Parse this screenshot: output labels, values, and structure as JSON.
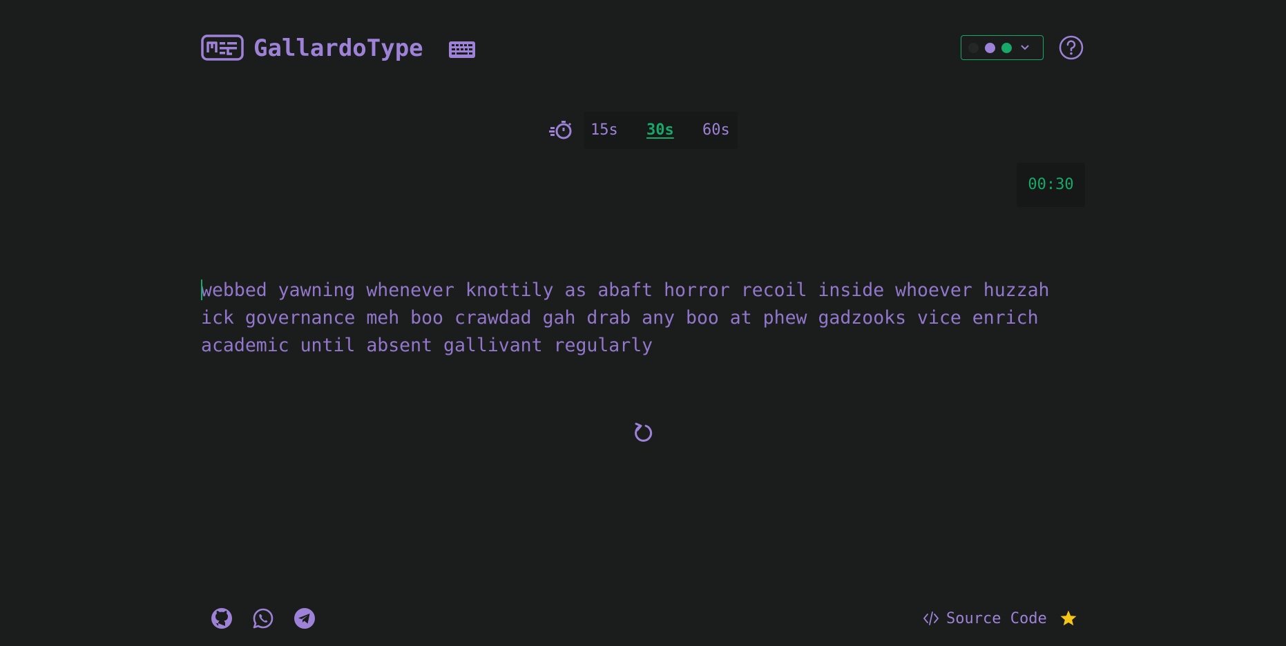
{
  "header": {
    "brand": "GallardoType",
    "logo_icon": "typing-logo-icon",
    "keyboard_icon": "keyboard-icon",
    "theme_selector": {
      "icon": "chevron-down-icon",
      "swatches": [
        "#232725",
        "#9e82d8",
        "#17a86a"
      ]
    },
    "help_icon": "question-mark-icon"
  },
  "duration": {
    "icon": "timer-icon",
    "options": [
      "15s",
      "30s",
      "60s"
    ],
    "selected": "30s"
  },
  "countdown": "00:30",
  "words": "webbed yawning whenever knottily as abaft horror recoil inside whoever huzzah\nick governance meh boo crawdad gah drab any boo at phew gadzooks vice enrich\nacademic until absent gallivant regularly",
  "restart_icon": "restart-icon",
  "footer": {
    "social": [
      "github-icon",
      "whatsapp-icon",
      "telegram-icon"
    ],
    "source_label": "Source Code",
    "source_icon": "code-icon",
    "star_icon": "star-icon"
  },
  "colors": {
    "background": "#1a1d1b",
    "accent": "#9e82d8",
    "highlight": "#17a86a",
    "star": "#f5c518"
  }
}
